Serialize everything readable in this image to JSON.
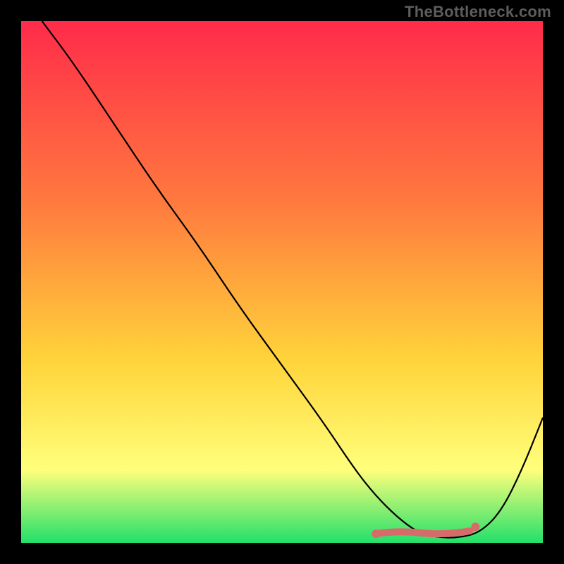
{
  "watermark": "TheBottleneck.com",
  "colors": {
    "top": "#ff2b4a",
    "mid_upper": "#ff7a3e",
    "mid_lower": "#ffd43a",
    "yellow_pale": "#ffff7b",
    "green": "#22e06a",
    "curve": "#000000",
    "highlight": "#d76b69",
    "frame_bg": "#000000"
  },
  "chart_data": {
    "type": "line",
    "title": "",
    "xlabel": "",
    "ylabel": "",
    "xlim": [
      0,
      100
    ],
    "ylim": [
      0,
      100
    ],
    "grid": false,
    "series": [
      {
        "name": "bottleneck-curve",
        "x": [
          4,
          10,
          18,
          26,
          34,
          42,
          50,
          58,
          64,
          68,
          72,
          76,
          80,
          84,
          88,
          92,
          96,
          100
        ],
        "y": [
          100,
          92,
          80,
          68,
          57,
          45,
          34,
          23,
          14,
          9,
          5,
          2,
          1,
          1,
          2,
          6,
          14,
          24
        ]
      }
    ],
    "highlight": {
      "name": "optimal-range",
      "x_range": [
        68,
        86
      ],
      "y": 2
    }
  }
}
